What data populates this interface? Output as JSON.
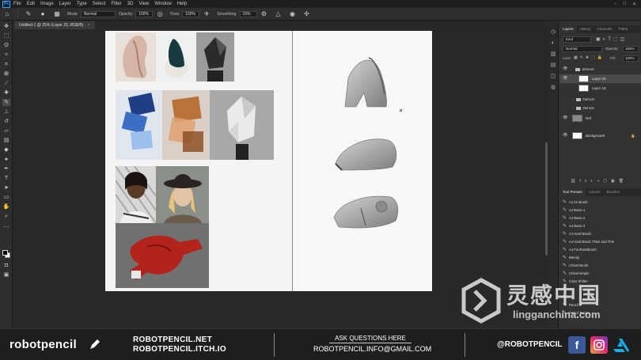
{
  "menu": {
    "logo": "Ps",
    "items": [
      "File",
      "Edit",
      "Image",
      "Layer",
      "Type",
      "Select",
      "Filter",
      "3D",
      "View",
      "Window",
      "Help"
    ]
  },
  "options": {
    "mode_label": "Mode:",
    "mode_value": "Normal",
    "opacity_label": "Opacity:",
    "opacity_value": "100%",
    "flow_label": "Flow:",
    "flow_value": "100%",
    "smoothing_label": "Smoothing:",
    "smoothing_value": "15%"
  },
  "document": {
    "tab_title": "Untitled-1 @ 25% (Layer 20, RGB/8)",
    "close": "×"
  },
  "layers_panel": {
    "tabs": [
      "Layers",
      "History",
      "Channels",
      "Paths"
    ],
    "filter_value": "Kind",
    "blend_mode": "Normal",
    "opacity_label": "Opacity:",
    "opacity_value": "100%",
    "lock_label": "Lock:",
    "fill_label": "Fill:",
    "fill_value": "100%",
    "layers": [
      {
        "name": "Demo3",
        "type": "group"
      },
      {
        "name": "Layer 20",
        "type": "layer",
        "selected": true
      },
      {
        "name": "Layer 19",
        "type": "layer"
      },
      {
        "name": "Demo2",
        "type": "group"
      },
      {
        "name": "Demo1",
        "type": "group"
      },
      {
        "name": "Ref",
        "type": "layer"
      },
      {
        "name": "Background",
        "type": "background"
      }
    ]
  },
  "presets_panel": {
    "tabs": [
      "Tool Presets",
      "Actions",
      "Brushes"
    ],
    "brushes": [
      "AJ Air Brush",
      "AJ Basic 1",
      "AJ Basic 2",
      "AJ Basic 3",
      "AJ Hard Brush",
      "AJ Hard Brush Thick and Thin",
      "AJ FunPaintBrush",
      "Blendy",
      "Chisel Brush",
      "Chisel simple",
      "Color Shifter",
      "",
      "",
      "Pencil 1",
      "Pencil Textury"
    ]
  },
  "footer": {
    "brand": "robotpencil",
    "link1": "ROBOTPENCIL.NET",
    "link2": "ROBOTPENCIL.ITCH.IO",
    "ask": "ASK QUESTIONS HERE",
    "email": "ROBOTPENCIL.INFO@GMAIL.COM",
    "handle": "@ROBOTPENCIL"
  },
  "watermark": {
    "cn": "灵感中国",
    "en": "lingganchina.com"
  },
  "icons": {
    "facebook": "facebook-icon",
    "instagram": "instagram-icon",
    "artstation": "artstation-icon"
  },
  "colors": {
    "facebook": "#3b5998",
    "artstation": "#13aff0",
    "ps_blue": "#31a8ff"
  }
}
